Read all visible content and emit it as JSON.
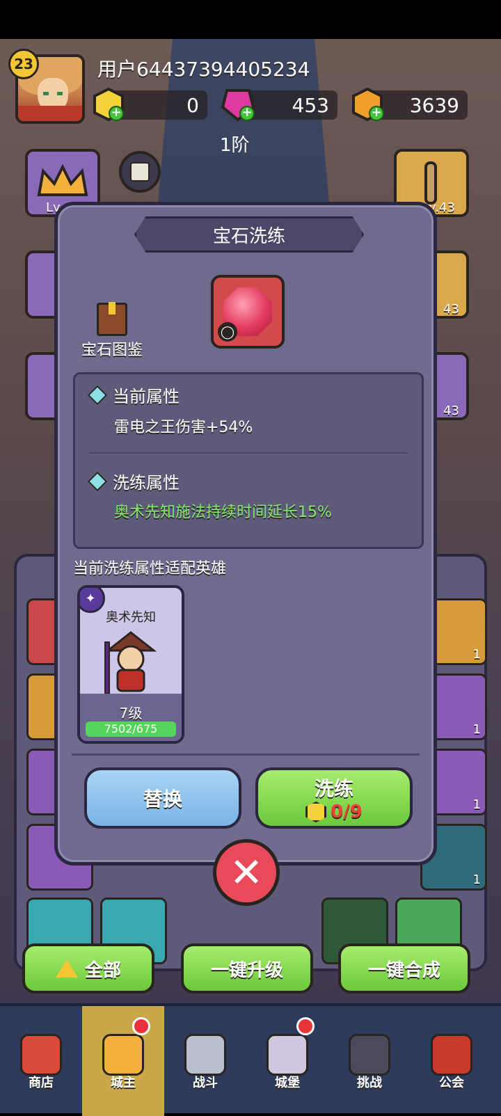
{
  "player": {
    "level": "23",
    "username": "用户64437394405234"
  },
  "resources": {
    "coins": "0",
    "gems": "453",
    "gold": "3639"
  },
  "stage_label": "1阶",
  "side_levels": {
    "left_top": "Lv.",
    "right_top": "Lv.43",
    "right_mid": "43",
    "right_low": "43"
  },
  "modal": {
    "title": "宝石洗练",
    "codex_label": "宝石图鉴",
    "current_attr_title": "当前属性",
    "current_attr_value": "雷电之王伤害+54%",
    "refine_attr_title": "洗练属性",
    "refine_attr_value": "奥术先知施法持续时间延长15%",
    "fit_label": "当前洗练属性适配英雄",
    "hero": {
      "name": "奥术先知",
      "level": "7级",
      "progress_text": "7502/675"
    },
    "replace_button": "替换",
    "refine_button": "洗练",
    "refine_cost": "0/9"
  },
  "inventory_counts": [
    "1",
    "1",
    "1",
    "1",
    "1",
    "1"
  ],
  "bottom_buttons": {
    "all": "全部",
    "upgrade_all": "一键升级",
    "merge_all": "一键合成"
  },
  "nav": {
    "shop": "商店",
    "lord": "城主",
    "battle": "战斗",
    "castle": "城堡",
    "challenge": "挑战",
    "guild": "公会"
  },
  "colors": {
    "modal_bg": "#6f6b8e",
    "current_attr_color": "#ffffff",
    "refine_attr_color": "#7fe86a",
    "cost_color": "#e8433a"
  }
}
